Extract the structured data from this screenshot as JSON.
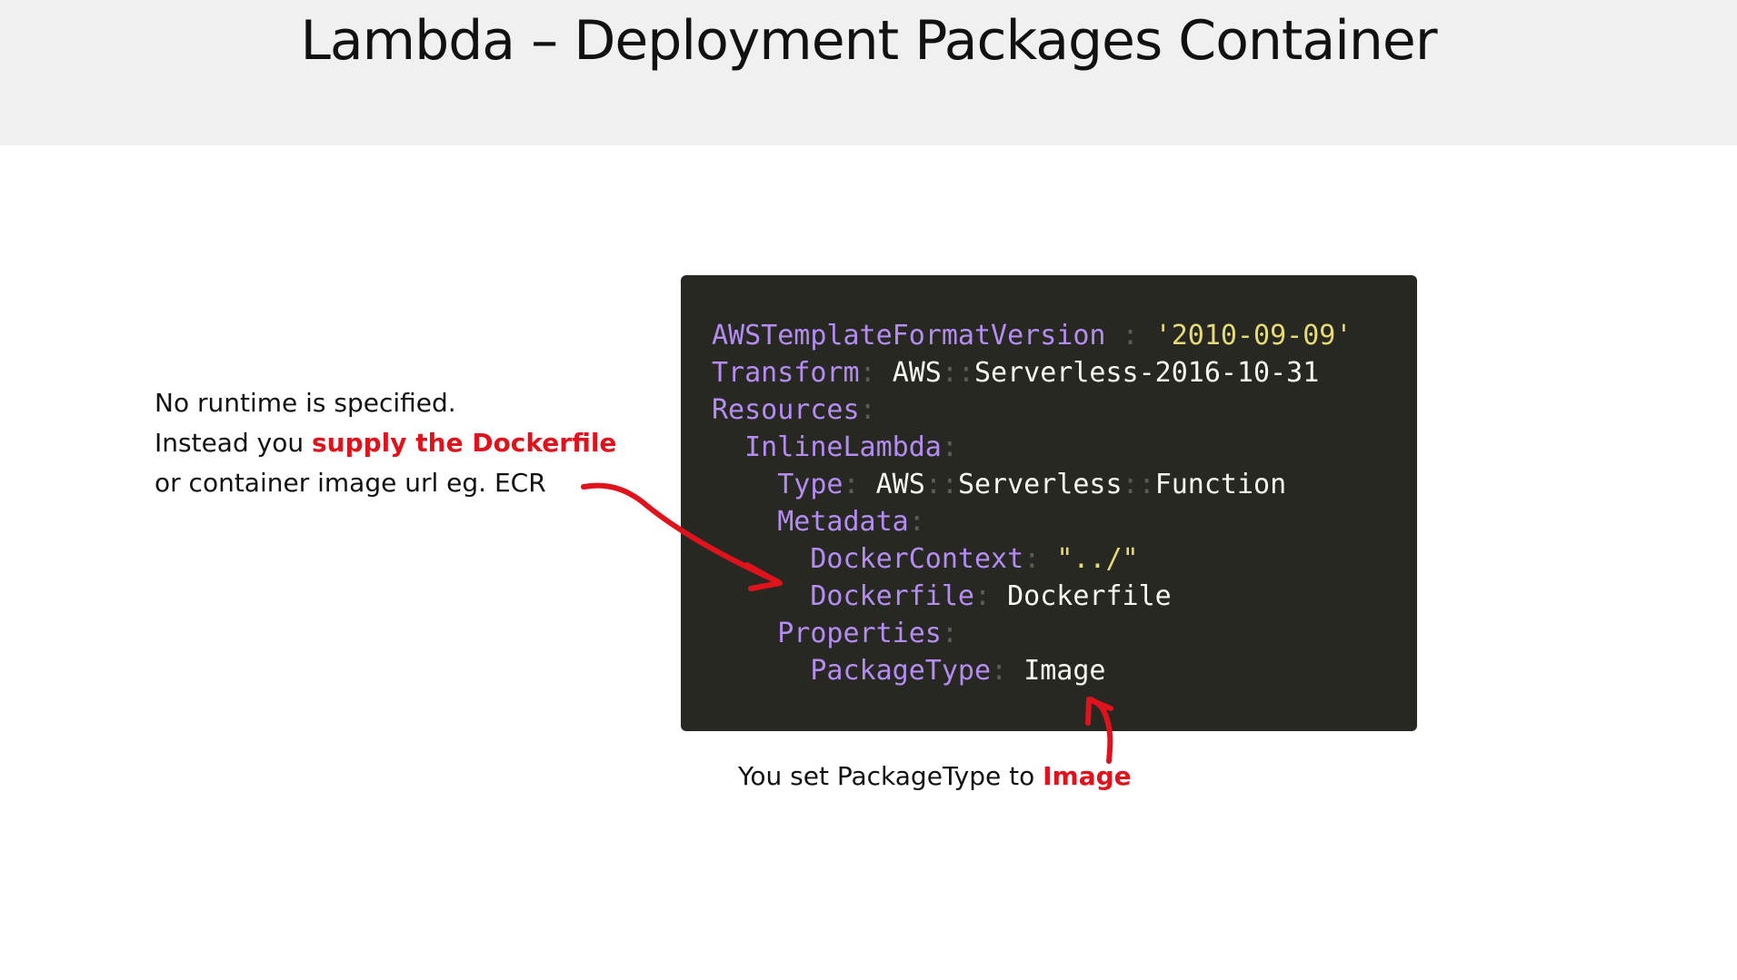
{
  "slide": {
    "title": "Lambda – Deployment Packages Container"
  },
  "left_note": {
    "line1": "No runtime is specified.",
    "line2_prefix": "Instead you ",
    "line2_highlight": "supply the Dockerfile",
    "line3": "or container image url eg. ECR"
  },
  "bottom_note": {
    "prefix": "You set PackageType to ",
    "highlight": "Image"
  },
  "code": {
    "l1_key": "AWSTemplateFormatVersion",
    "l1_sep": " : ",
    "l1_val": "'2010-09-09'",
    "l2_key": "Transform",
    "l2_colon": ":",
    "l2_val_a": "AWS",
    "l2_dcolon": "::",
    "l2_val_b": "Serverless-2016-10-31",
    "l3_key": "Resources",
    "l3_colon": ":",
    "l4_key": "InlineLambda",
    "l4_colon": ":",
    "l5_key": "Type",
    "l5_colon": ":",
    "l5_val_a": "AWS",
    "l5_dcolon1": "::",
    "l5_val_b": "Serverless",
    "l5_dcolon2": "::",
    "l5_val_c": "Function",
    "l6_key": "Metadata",
    "l6_colon": ":",
    "l7_key": "DockerContext",
    "l7_colon": ":",
    "l7_val": "\"../\"",
    "l8_key": "Dockerfile",
    "l8_colon": ":",
    "l8_val": "Dockerfile",
    "l9_key": "Properties",
    "l9_colon": ":",
    "l10_key": "PackageType",
    "l10_colon": ":",
    "l10_val": "Image"
  },
  "colors": {
    "highlight": "#e0131c",
    "code_background": "#272822",
    "code_key": "#b48cf2",
    "code_string": "#e6db74",
    "header_background": "#f0f0f0"
  }
}
